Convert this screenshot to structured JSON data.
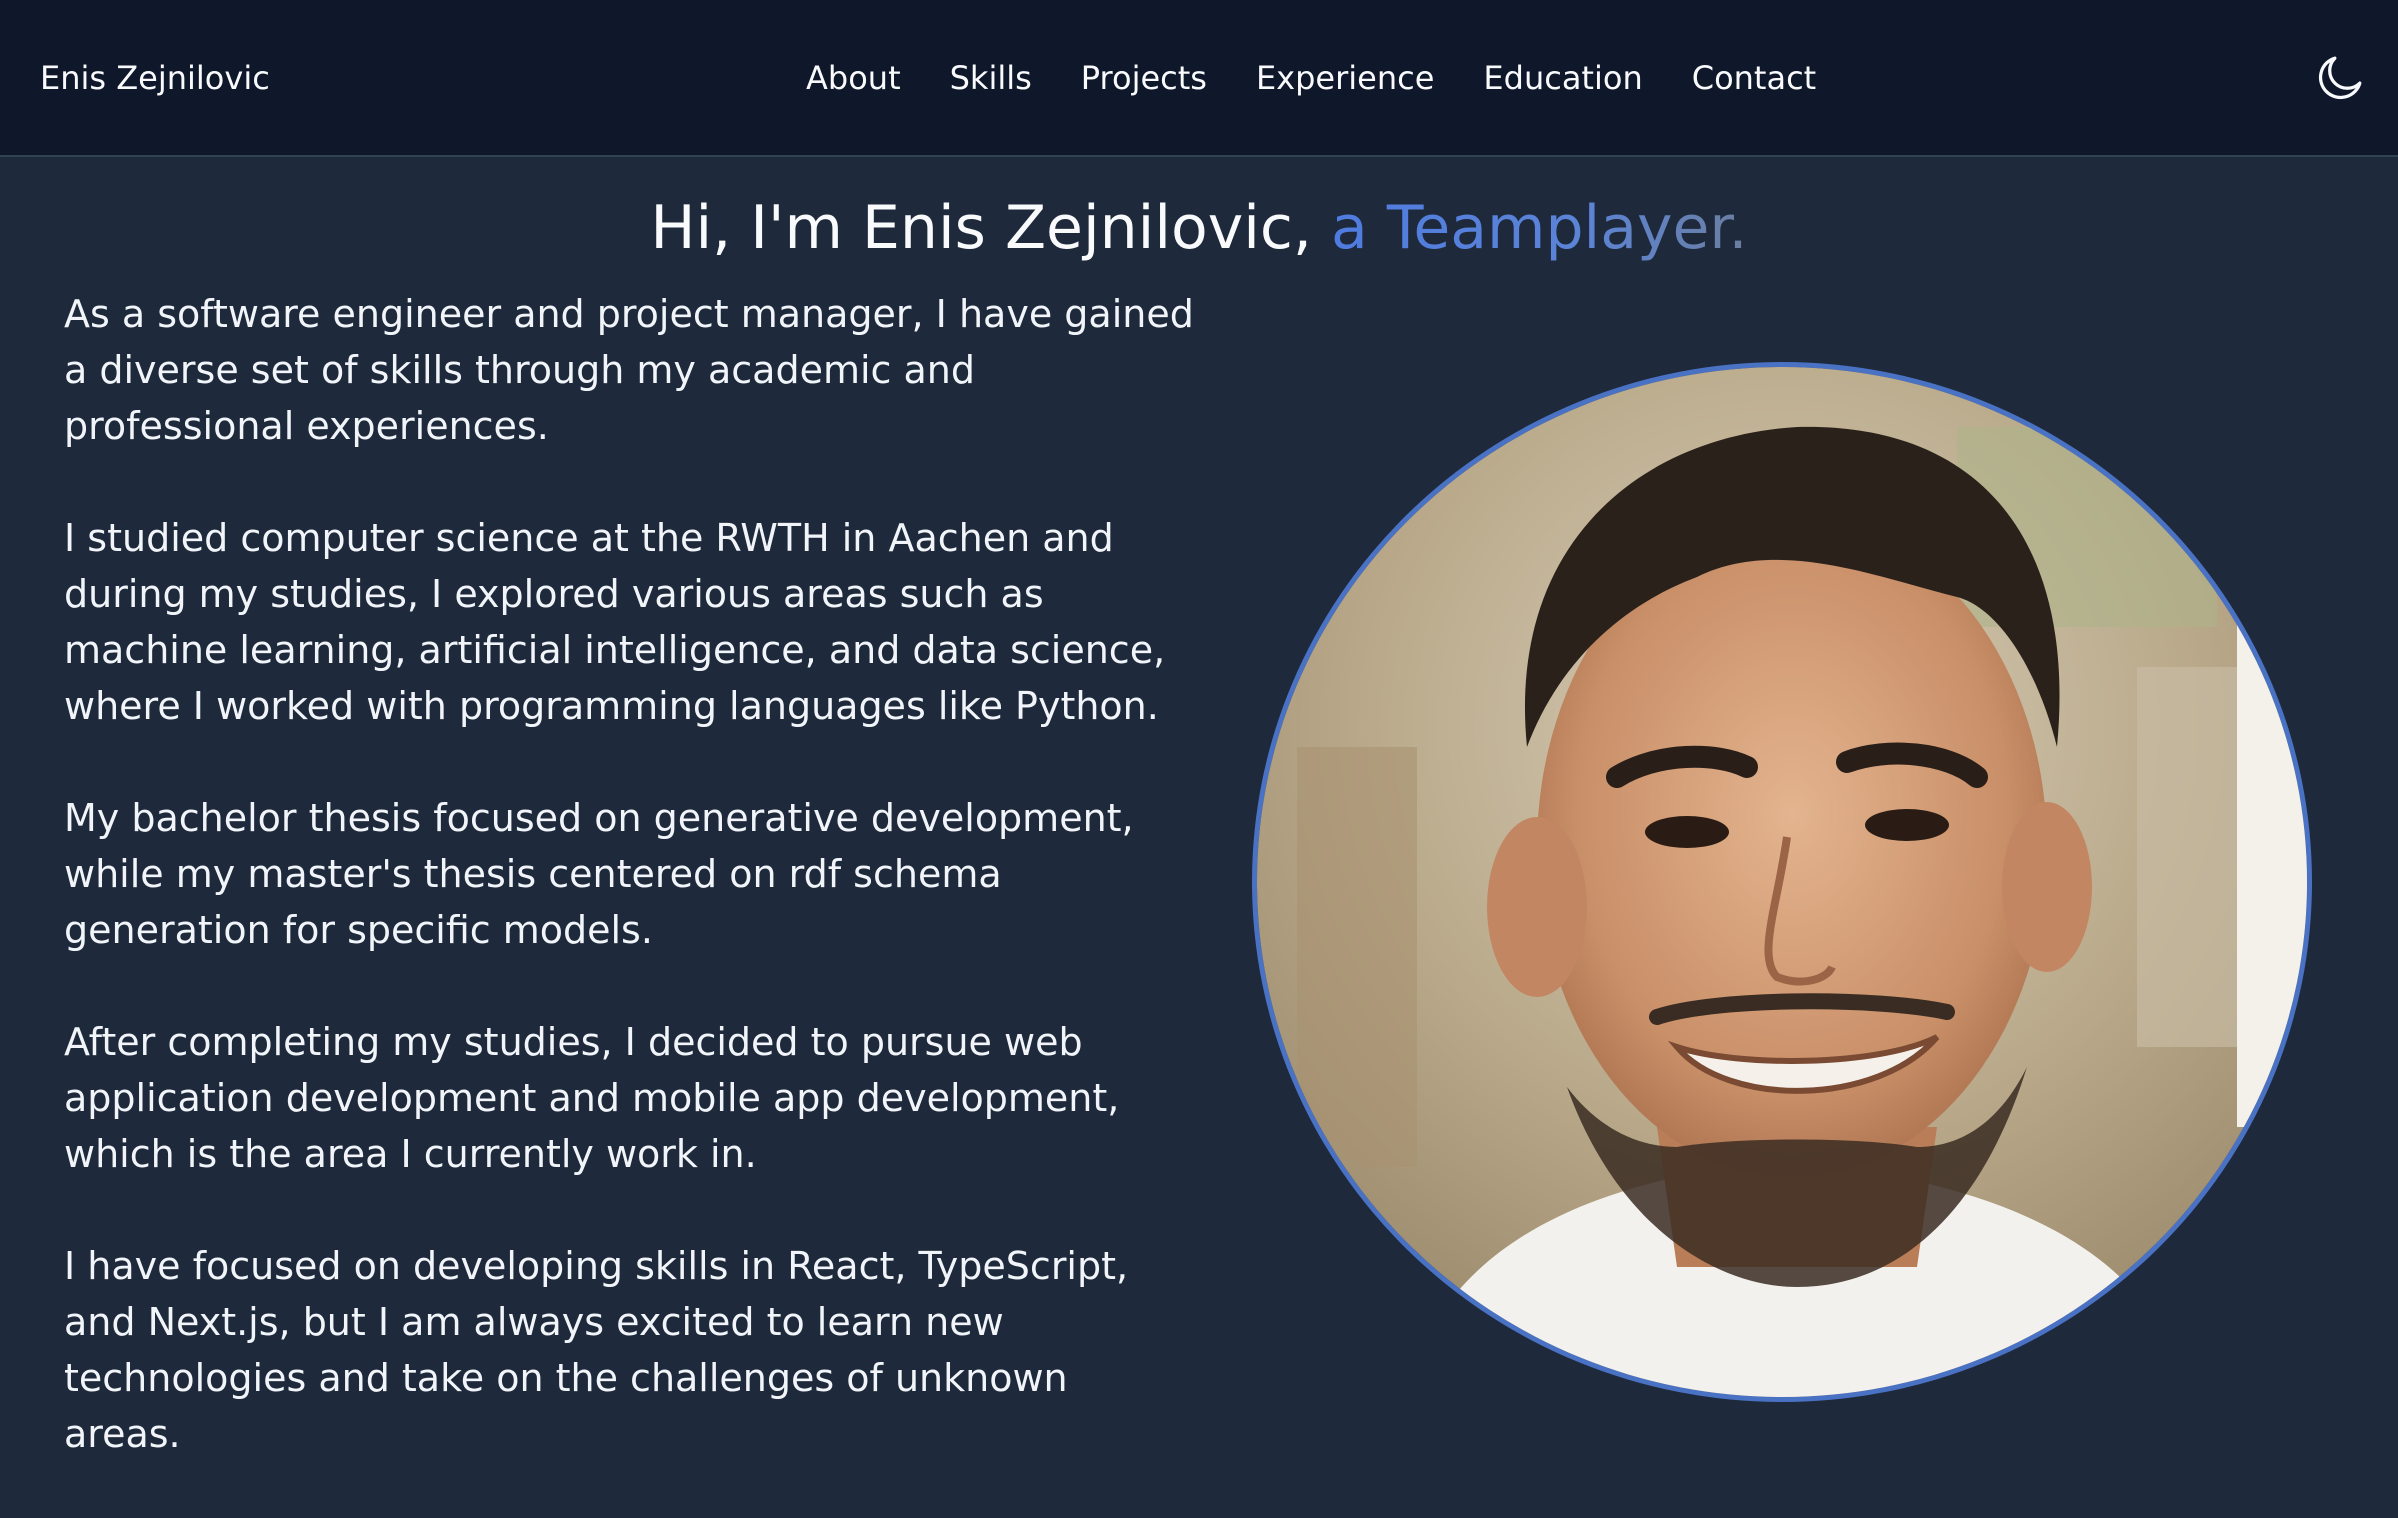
{
  "navbar": {
    "brand": "Enis Zejnilovic",
    "links": [
      {
        "label": "About"
      },
      {
        "label": "Skills"
      },
      {
        "label": "Projects"
      },
      {
        "label": "Experience"
      },
      {
        "label": "Education"
      },
      {
        "label": "Contact"
      }
    ],
    "theme_toggle_icon": "moon-icon"
  },
  "hero": {
    "greeting": "Hi, I'm Enis Zejnilovic,",
    "tagline": "a Teamplayer."
  },
  "about": {
    "paragraphs": [
      "As a software engineer and project manager, I have gained a diverse set of skills through my academic and professional experiences.",
      "I studied computer science at the RWTH in Aachen and during my studies, I explored various areas such as machine learning, artificial intelligence, and data science, where I worked with programming languages like Python.",
      "My bachelor thesis focused on generative development, while my master's thesis centered on rdf schema generation for specific models.",
      "After completing my studies, I decided to pursue web application development and mobile app development, which is the area I currently work in.",
      "I have focused on developing skills in React, TypeScript, and Next.js, but I am always excited to learn new technologies and take on the challenges of unknown areas."
    ]
  },
  "colors": {
    "background": "#1e293b",
    "navbar": "#0f172a",
    "accent": "#4f7be0",
    "text": "#f8fafc"
  }
}
